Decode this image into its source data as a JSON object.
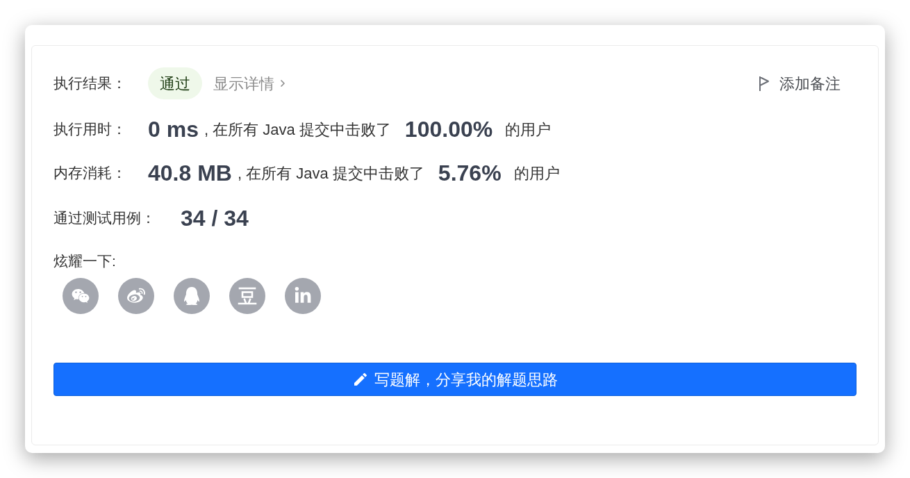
{
  "result": {
    "label": "执行结果：",
    "status": "通过",
    "details_link": "显示详情",
    "note_button": "添加备注"
  },
  "stats": [
    {
      "label": "执行用时：",
      "value": "0 ms",
      "comparison": ", 在所有 Java 提交中击败了",
      "percent": "100.00%",
      "suffix": "的用户"
    },
    {
      "label": "内存消耗：",
      "value": "40.8 MB",
      "comparison": ", 在所有 Java 提交中击败了",
      "percent": "5.76%",
      "suffix": "的用户"
    }
  ],
  "test_cases": {
    "label": "通过测试用例：",
    "value": "34 / 34"
  },
  "share": {
    "label": "炫耀一下:"
  },
  "solution_button": "写题解，分享我的解题思路"
}
